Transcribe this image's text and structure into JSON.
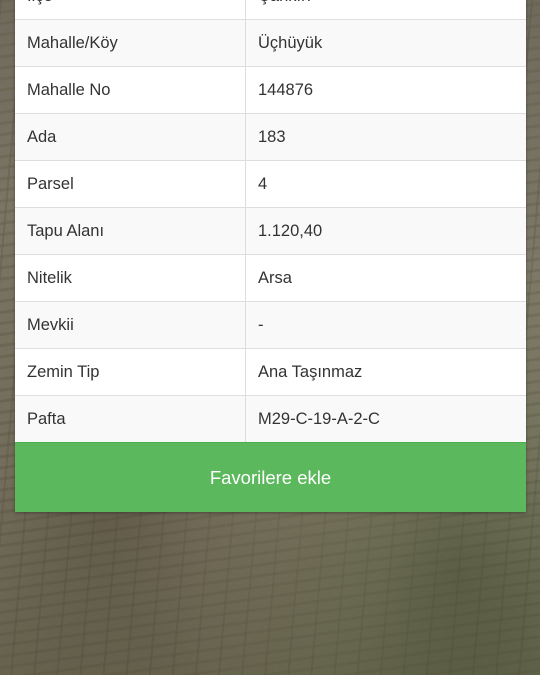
{
  "property_info": {
    "rows": [
      {
        "label": "İlçe",
        "value": "Çankırı"
      },
      {
        "label": "Mahalle/Köy",
        "value": "Üçhüyük"
      },
      {
        "label": "Mahalle No",
        "value": "144876"
      },
      {
        "label": "Ada",
        "value": "183"
      },
      {
        "label": "Parsel",
        "value": "4"
      },
      {
        "label": "Tapu Alanı",
        "value": "1.120,40"
      },
      {
        "label": "Nitelik",
        "value": "Arsa"
      },
      {
        "label": "Mevkii",
        "value": "-"
      },
      {
        "label": "Zemin Tip",
        "value": "Ana Taşınmaz"
      },
      {
        "label": "Pafta",
        "value": "M29-C-19-A-2-C"
      }
    ]
  },
  "actions": {
    "favorite_label": "Favorilere ekle",
    "favorite_color": "#5cb85c"
  },
  "map": {
    "type": "satellite imagery"
  }
}
